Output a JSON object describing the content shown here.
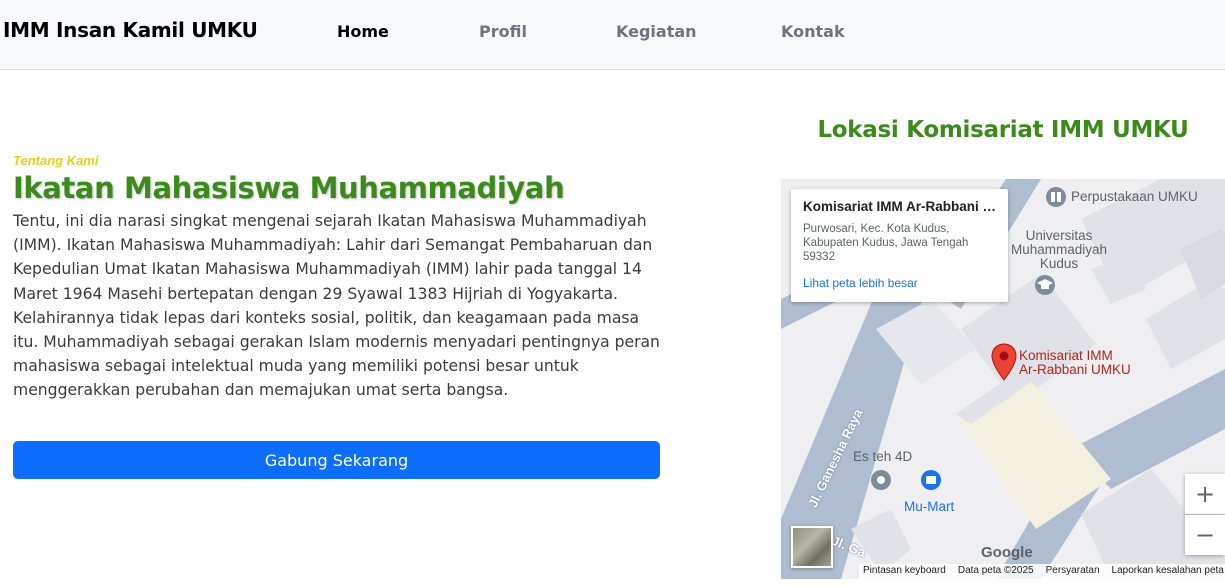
{
  "nav": {
    "brand": "IMM Insan Kamil UMKU",
    "links": [
      {
        "label": "Home",
        "active": true
      },
      {
        "label": "Profil",
        "active": false
      },
      {
        "label": "Kegiatan",
        "active": false
      },
      {
        "label": "Kontak",
        "active": false
      }
    ]
  },
  "about": {
    "eyebrow": "Tentang Kami",
    "title": "Ikatan Mahasiswa Muhammadiyah",
    "description": "Tentu, ini dia narasi singkat mengenai sejarah Ikatan Mahasiswa Muhammadiyah (IMM). Ikatan Mahasiswa Muhammadiyah: Lahir dari Semangat Pembaharuan dan Kepedulian Umat Ikatan Mahasiswa Muhammadiyah (IMM) lahir pada tanggal 14 Maret 1964 Masehi bertepatan dengan 29 Syawal 1383 Hijriah di Yogyakarta. Kelahirannya tidak lepas dari konteks sosial, politik, dan keagamaan pada masa itu. Muhammadiyah sebagai gerakan Islam modernis menyadari pentingnya peran mahasiswa sebagai intelektual muda yang memiliki potensi besar untuk menggerakkan perubahan dan memajukan umat serta bangsa.",
    "cta_label": "Gabung Sekarang"
  },
  "location": {
    "title": "Lokasi Komisariat IMM UMKU",
    "map": {
      "card_title": "Komisariat IMM Ar-Rabbani U...",
      "card_address": "Purwosari, Kec. Kota Kudus, Kabupaten Kudus, Jawa Tengah 59332",
      "card_link": "Lihat peta lebih besar",
      "labels": {
        "library": "Perpustakaan UMKU",
        "university_line1": "Universitas",
        "university_line2": "Muhammadiyah",
        "university_line3": "Kudus",
        "pin_line1": "Komisariat IMM",
        "pin_line2": "Ar-Rabbani UMKU",
        "road": "Jl. Ganesha Raya",
        "road_bottom": "Jl. Ga",
        "es_teh": "Es teh 4D",
        "mu_mart": "Mu-Mart"
      },
      "google": "Google",
      "attribution": [
        "Pintasan keyboard",
        "Data peta ©2025",
        "Persyaratan",
        "Laporkan kesalahan peta"
      ],
      "zoom_in": "+",
      "zoom_out": "−"
    },
    "colors": {
      "accent_green": "#3c8a1c",
      "eyebrow_yellow": "#e6cf1a",
      "button_blue": "#0d6efd",
      "pin_red": "#ea4335"
    }
  }
}
